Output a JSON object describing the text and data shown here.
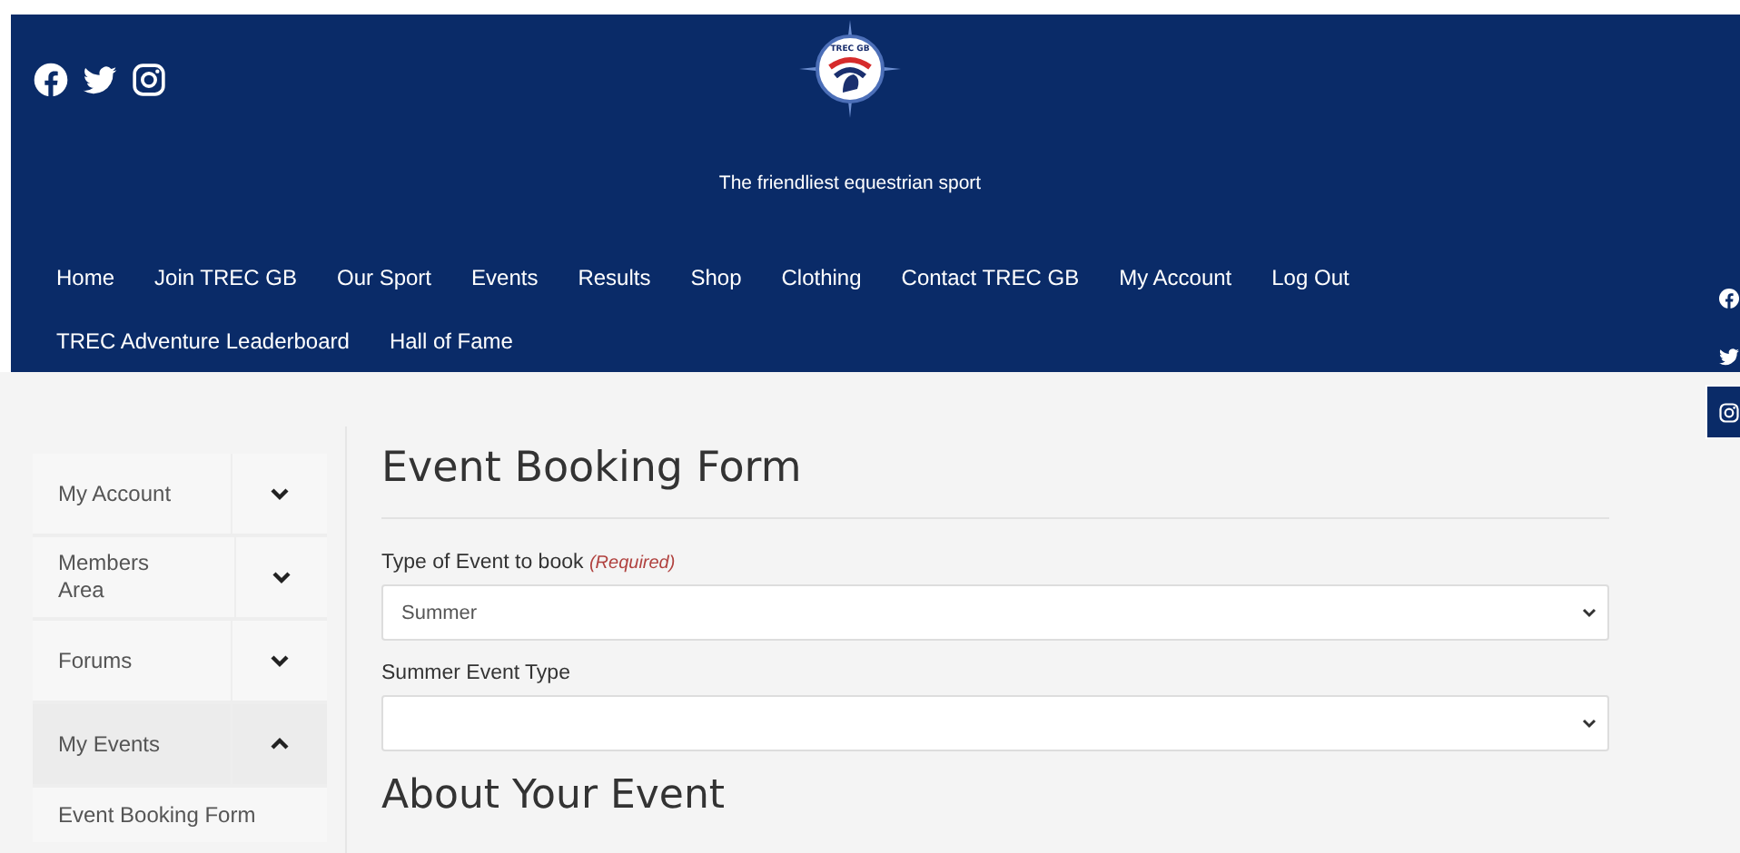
{
  "header": {
    "social_links": [
      {
        "kind": "facebook"
      },
      {
        "kind": "twitter"
      },
      {
        "kind": "instagram"
      }
    ],
    "logo": {
      "text": "TREC GB"
    },
    "tagline": "The friendliest equestrian sport",
    "nav": [
      [
        "Home",
        "Join TREC GB",
        "Our Sport",
        "Events",
        "Results",
        "Shop",
        "Clothing",
        "Contact TREC GB",
        "My Account",
        "Log Out"
      ],
      [
        "TREC Adventure Leaderboard",
        "Hall of Fame"
      ]
    ]
  },
  "floating_social": [
    {
      "kind": "facebook"
    },
    {
      "kind": "twitter"
    },
    {
      "kind": "instagram"
    }
  ],
  "sidebar": {
    "items": [
      {
        "label": "My Account",
        "expanded": false
      },
      {
        "label": "Members Area",
        "expanded": false
      },
      {
        "label": "Forums",
        "expanded": false
      },
      {
        "label": "My Events",
        "expanded": true,
        "children": [
          "Event Booking Form"
        ]
      }
    ]
  },
  "main": {
    "title": "Event Booking Form",
    "fields": [
      {
        "label": "Type of Event to book",
        "required_note": "(Required)",
        "value": "Summer"
      },
      {
        "label": "Summer Event Type"
      }
    ],
    "section_heading": "About Your Event"
  }
}
